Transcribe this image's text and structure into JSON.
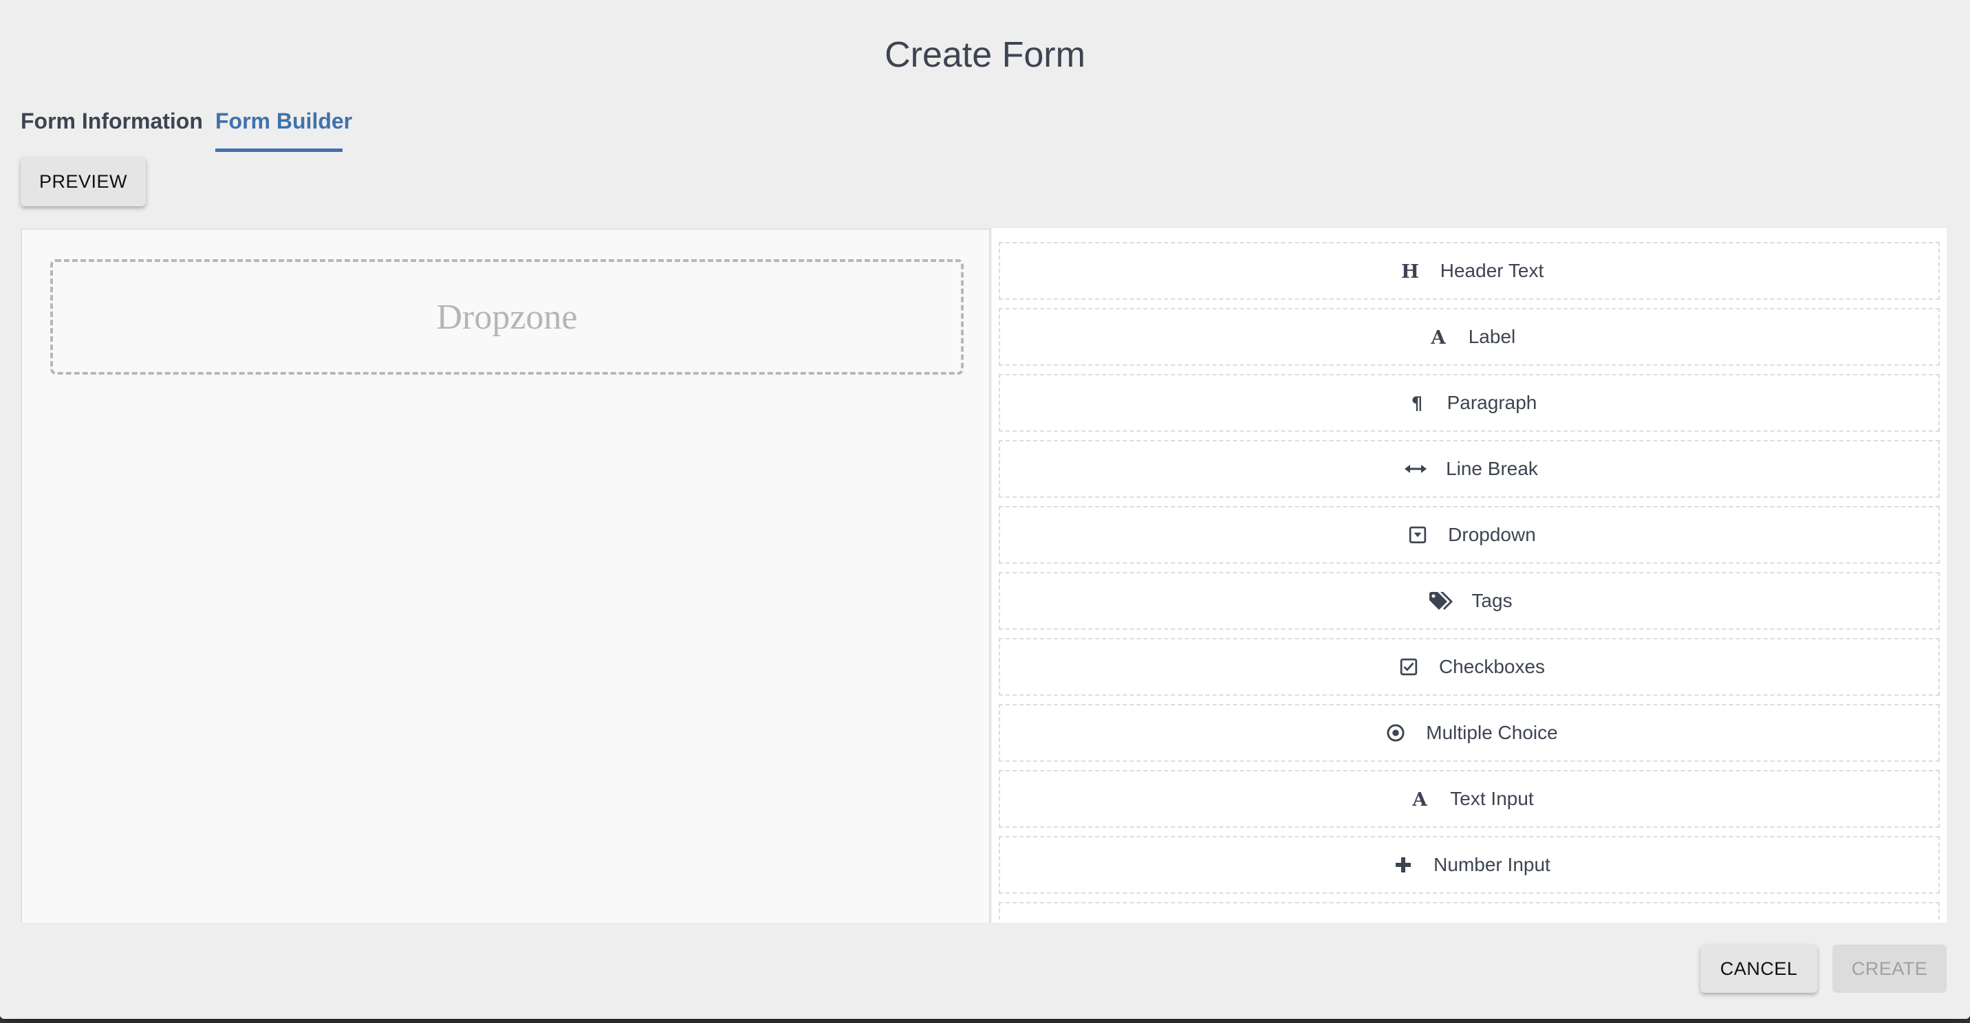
{
  "dialog": {
    "title": "Create Form"
  },
  "tabs": [
    {
      "label": "Form Information",
      "active": false
    },
    {
      "label": "Form Builder",
      "active": true
    }
  ],
  "toolbar": {
    "preview_label": "PREVIEW"
  },
  "canvas": {
    "dropzone_label": "Dropzone"
  },
  "toolbox": {
    "items": [
      {
        "label": "Header Text",
        "icon": "header-icon"
      },
      {
        "label": "Label",
        "icon": "font-icon"
      },
      {
        "label": "Paragraph",
        "icon": "paragraph-icon"
      },
      {
        "label": "Line Break",
        "icon": "arrows-horizontal-icon"
      },
      {
        "label": "Dropdown",
        "icon": "caret-square-down-icon"
      },
      {
        "label": "Tags",
        "icon": "tags-icon"
      },
      {
        "label": "Checkboxes",
        "icon": "check-square-icon"
      },
      {
        "label": "Multiple Choice",
        "icon": "dot-circle-icon"
      },
      {
        "label": "Text Input",
        "icon": "font-icon"
      },
      {
        "label": "Number Input",
        "icon": "plus-icon"
      }
    ]
  },
  "footer": {
    "cancel_label": "CANCEL",
    "create_label": "CREATE",
    "create_disabled": true
  },
  "colors": {
    "accent": "#3f72ad",
    "text": "#3d4451",
    "background": "#eeeeee"
  }
}
